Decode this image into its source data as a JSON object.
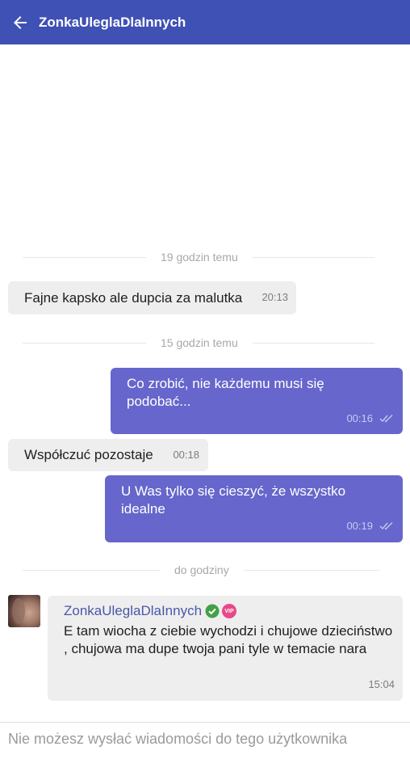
{
  "header": {
    "title": "ZonkaUleglaDlaInnych",
    "back_icon": "arrow-left-icon",
    "background": "#3f51b5"
  },
  "separators": [
    "19 godzin temu",
    "15 godzin temu",
    "do godziny"
  ],
  "messages": [
    {
      "direction": "incoming",
      "text": "Fajne kapsko ale dupcia za malutka",
      "time": "20:13"
    },
    {
      "direction": "outgoing",
      "text": "Co zrobić, nie każdemu musi się podobać...",
      "time": "00:16",
      "status_icon": "double-check-icon"
    },
    {
      "direction": "incoming",
      "text": "Współczuć pozostaje",
      "time": "00:18"
    },
    {
      "direction": "outgoing",
      "text": "U Was tylko się cieszyć, że wszystko idealne",
      "time": "00:19",
      "status_icon": "double-check-icon"
    },
    {
      "direction": "incoming",
      "sender": "ZonkaUleglaDlaInnych",
      "verified_icon": "verified-check-icon",
      "badge": "VIP",
      "text": "E tam wiocha z ciebie wychodzi i chujowe dzieciństwo , chujowa ma dupe twoja pani tyle w temacie nara",
      "time": "15:04"
    }
  ],
  "composer": {
    "notice": "Nie możesz wysłać wiadomości do tego użytkownika"
  },
  "colors": {
    "outgoing_bubble": "#6666cc",
    "incoming_bubble": "#eeeeee",
    "sender_name": "#4a57a8",
    "verified": "#43a047",
    "vip": "#e8488a"
  }
}
